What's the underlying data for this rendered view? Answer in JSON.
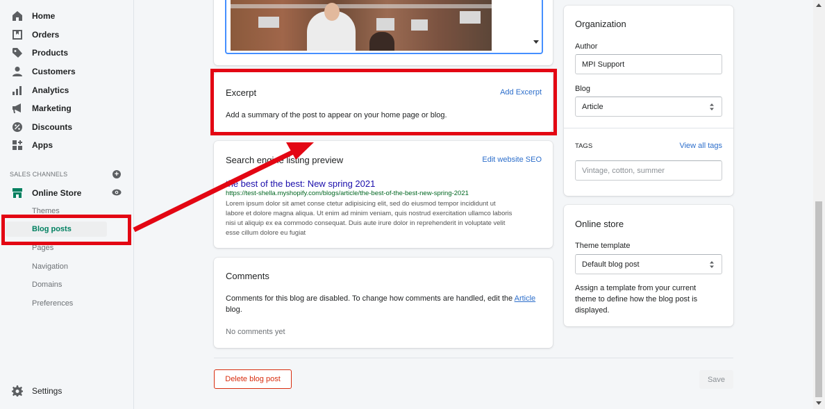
{
  "sidebar": {
    "items": [
      {
        "label": "Home",
        "icon": "home-icon"
      },
      {
        "label": "Orders",
        "icon": "orders-icon"
      },
      {
        "label": "Products",
        "icon": "tag-icon"
      },
      {
        "label": "Customers",
        "icon": "person-icon"
      },
      {
        "label": "Analytics",
        "icon": "bar-chart-icon"
      },
      {
        "label": "Marketing",
        "icon": "megaphone-icon"
      },
      {
        "label": "Discounts",
        "icon": "discount-icon"
      },
      {
        "label": "Apps",
        "icon": "apps-icon"
      }
    ],
    "sales_channels_title": "SALES CHANNELS",
    "online_store": "Online Store",
    "sub_items": [
      "Themes",
      "Blog posts",
      "Pages",
      "Navigation",
      "Domains",
      "Preferences"
    ],
    "settings": "Settings"
  },
  "excerpt": {
    "title": "Excerpt",
    "action": "Add Excerpt",
    "description": "Add a summary of the post to appear on your home page or blog."
  },
  "seo": {
    "title": "Search engine listing preview",
    "action": "Edit website SEO",
    "page_title": "the best of the best: New spring 2021",
    "url": "https://test-shella.myshopify.com/blogs/article/the-best-of-the-best-new-spring-2021",
    "description_lines": [
      "Lorem ipsum dolor sit amet conse ctetur adipisicing elit, sed do eiusmod tempor incididunt ut",
      "labore et dolore magna aliqua. Ut enim ad minim veniam, quis nostrud exercitation ullamco laboris",
      "nisi ut aliquip ex ea commodo consequat. Duis aute irure dolor in reprehenderit in voluptate velit",
      "esse cillum dolore eu fugiat"
    ]
  },
  "comments": {
    "title": "Comments",
    "text_before": "Comments for this blog are disabled. To change how comments are handled, edit the",
    "link": "Article",
    "text_after": "blog.",
    "empty": "No comments yet"
  },
  "organization": {
    "title": "Organization",
    "author_label": "Author",
    "author_value": "MPI Support",
    "blog_label": "Blog",
    "blog_value": "Article",
    "tags_label": "TAGS",
    "tags_action": "View all tags",
    "tags_placeholder": "Vintage, cotton, summer"
  },
  "online_store": {
    "title": "Online store",
    "template_label": "Theme template",
    "template_value": "Default blog post",
    "help_lines": [
      "Assign a template from your current",
      "theme to define how the blog post is",
      "displayed."
    ]
  },
  "actions": {
    "delete": "Delete blog post",
    "save": "Save"
  },
  "colors": {
    "annotation_red": "#e30613",
    "active_green": "#008060",
    "link_blue": "#2c6ecb"
  }
}
